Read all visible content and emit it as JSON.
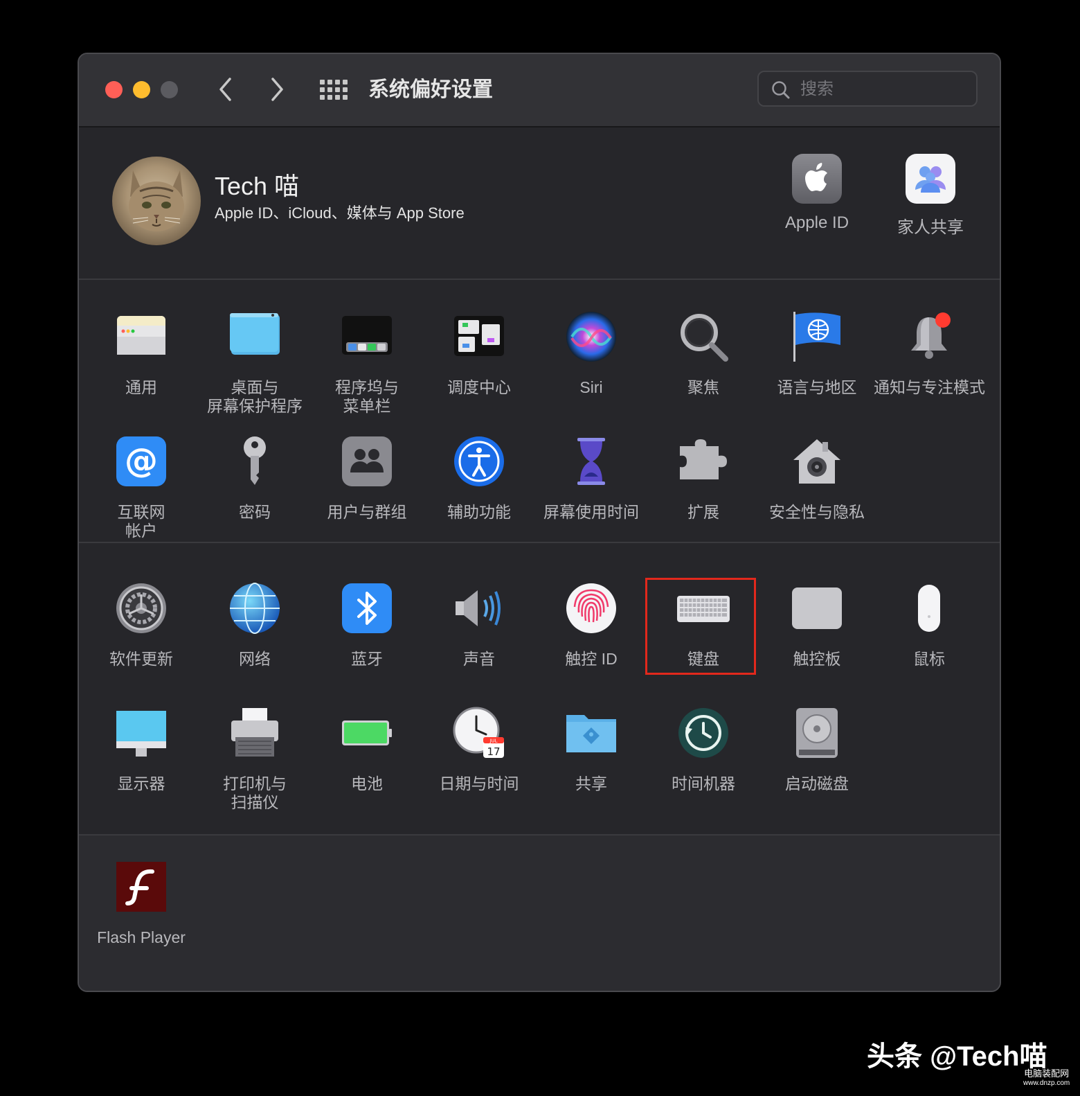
{
  "window": {
    "title": "系统偏好设置",
    "search_placeholder": "搜索"
  },
  "account": {
    "name": "Tech 喵",
    "subtitle": "Apple ID、iCloud、媒体与 App Store",
    "items": [
      {
        "label": "Apple ID",
        "icon": "apple-logo-icon"
      },
      {
        "label": "家人共享",
        "icon": "family-sharing-icon"
      }
    ]
  },
  "section1": [
    {
      "label": "通用",
      "icon": "general-icon"
    },
    {
      "label": "桌面与\n屏幕保护程序",
      "icon": "desktop-icon"
    },
    {
      "label": "程序坞与\n菜单栏",
      "icon": "dock-icon"
    },
    {
      "label": "调度中心",
      "icon": "mission-control-icon"
    },
    {
      "label": "Siri",
      "icon": "siri-icon"
    },
    {
      "label": "聚焦",
      "icon": "spotlight-icon"
    },
    {
      "label": "语言与地区",
      "icon": "language-flag-icon"
    },
    {
      "label": "通知与专注模式",
      "icon": "notification-bell-icon"
    },
    {
      "label": "互联网\n帐户",
      "icon": "internet-accounts-icon"
    },
    {
      "label": "密码",
      "icon": "key-icon"
    },
    {
      "label": "用户与群组",
      "icon": "users-icon"
    },
    {
      "label": "辅助功能",
      "icon": "accessibility-icon"
    },
    {
      "label": "屏幕使用时间",
      "icon": "hourglass-icon"
    },
    {
      "label": "扩展",
      "icon": "puzzle-icon"
    },
    {
      "label": "安全性与隐私",
      "icon": "security-house-icon"
    }
  ],
  "section2": [
    {
      "label": "软件更新",
      "icon": "gear-icon"
    },
    {
      "label": "网络",
      "icon": "globe-icon"
    },
    {
      "label": "蓝牙",
      "icon": "bluetooth-icon"
    },
    {
      "label": "声音",
      "icon": "speaker-icon"
    },
    {
      "label": "触控 ID",
      "icon": "fingerprint-icon"
    },
    {
      "label": "键盘",
      "icon": "keyboard-icon",
      "highlighted": true
    },
    {
      "label": "触控板",
      "icon": "trackpad-icon"
    },
    {
      "label": "鼠标",
      "icon": "mouse-icon"
    },
    {
      "label": "显示器",
      "icon": "display-icon"
    },
    {
      "label": "打印机与\n扫描仪",
      "icon": "printer-icon"
    },
    {
      "label": "电池",
      "icon": "battery-icon"
    },
    {
      "label": "日期与时间",
      "icon": "clock-calendar-icon"
    },
    {
      "label": "共享",
      "icon": "sharing-folder-icon"
    },
    {
      "label": "时间机器",
      "icon": "time-machine-icon"
    },
    {
      "label": "启动磁盘",
      "icon": "hard-disk-icon"
    }
  ],
  "section3": [
    {
      "label": "Flash Player",
      "icon": "flash-icon"
    }
  ],
  "calendar_icon": {
    "month": "JUL",
    "day": "17"
  },
  "watermark": {
    "text": "头条 @Tech喵",
    "site": "电脑装配网",
    "url": "www.dnzp.com"
  },
  "colors": {
    "highlight": "#e2281c",
    "window_bg": "#26262a",
    "titlebar": "#323236"
  }
}
